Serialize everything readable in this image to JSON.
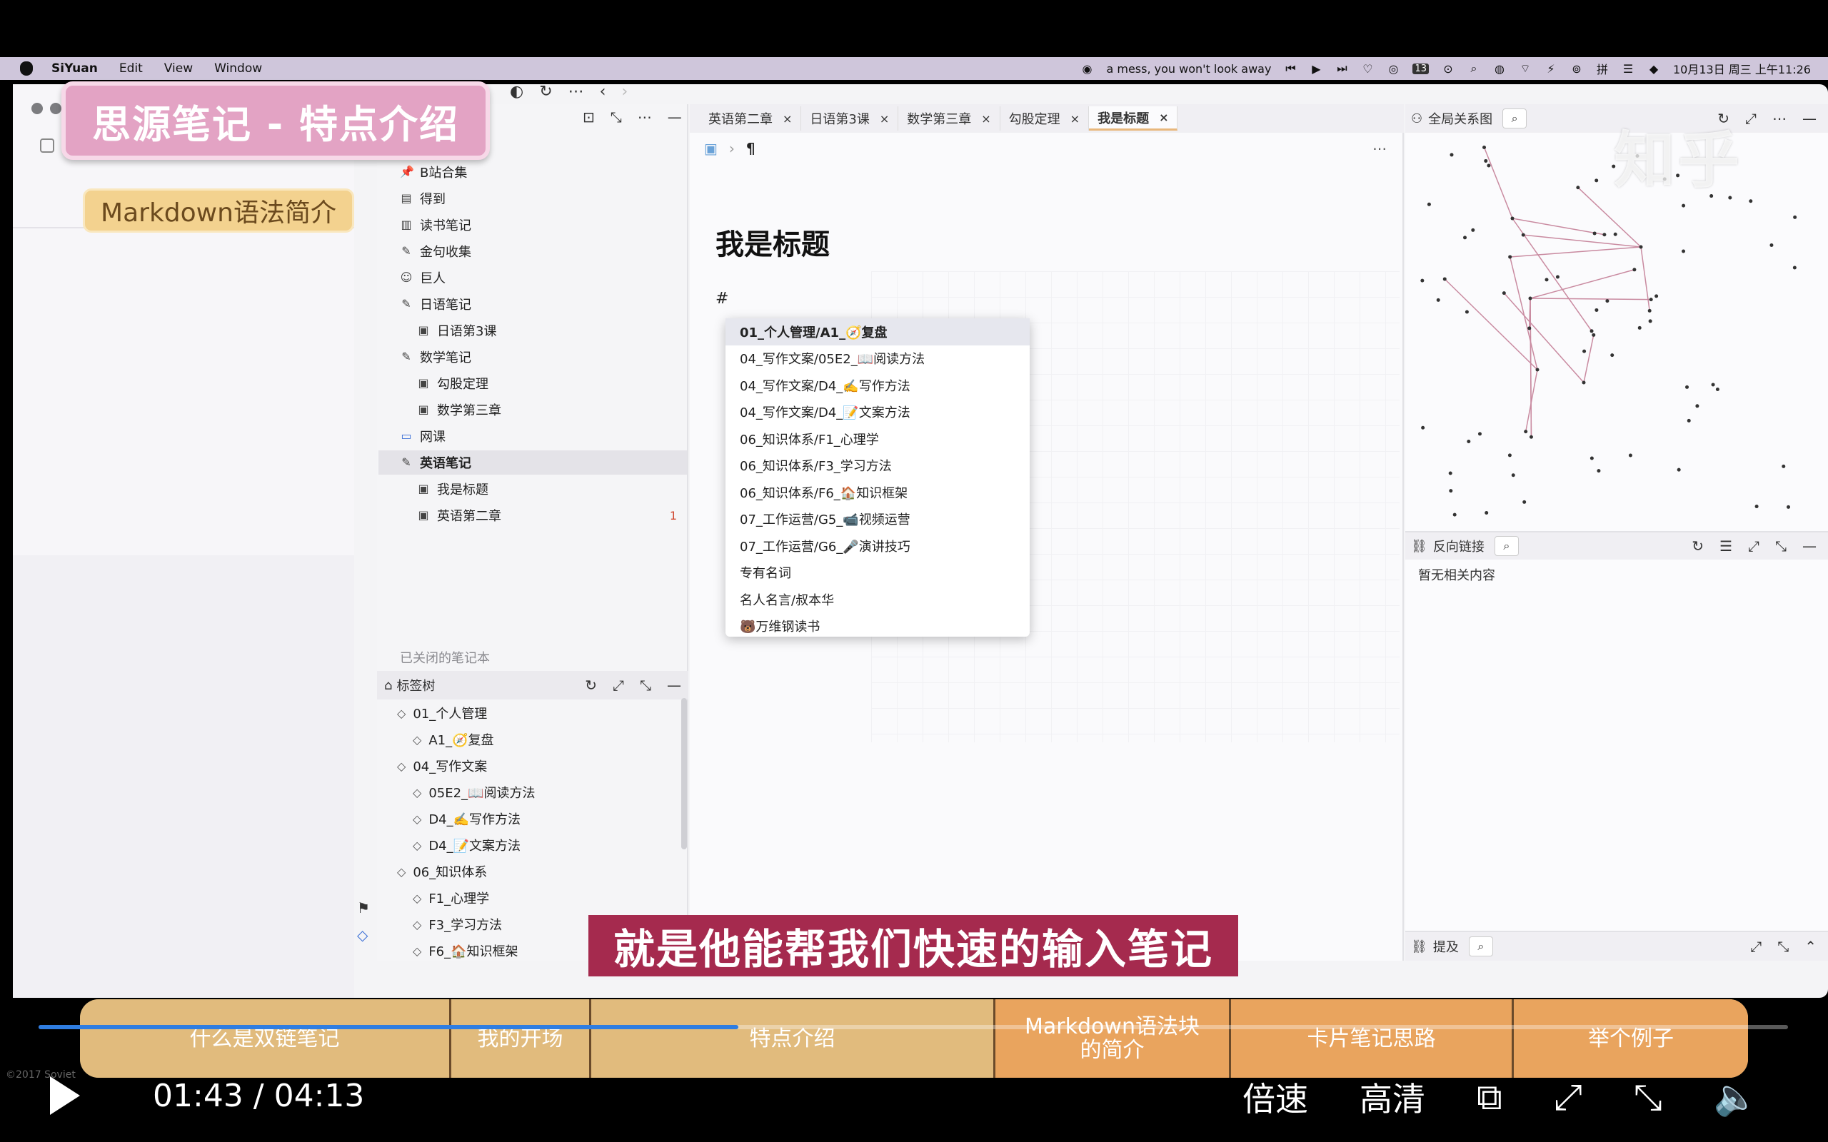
{
  "menubar": {
    "app_name": "SiYuan",
    "menus": [
      "Edit",
      "View",
      "Window"
    ],
    "now_playing": "a mess, you won't look away",
    "calendar_badge": "13",
    "datetime": "10月13日 周三 上午11:26"
  },
  "overlay": {
    "title": "思源笔记 - 特点介绍",
    "subtitle": "Markdown语法简介"
  },
  "notebook_tree": {
    "items": [
      {
        "label": "B站合集",
        "icon": "pin-icon",
        "level": 1
      },
      {
        "label": "得到",
        "icon": "folder-icon",
        "level": 1
      },
      {
        "label": "读书笔记",
        "icon": "book-icon",
        "level": 1
      },
      {
        "label": "金句收集",
        "icon": "note-icon",
        "level": 1
      },
      {
        "label": "巨人",
        "icon": "person-icon",
        "level": 1
      },
      {
        "label": "日语笔记",
        "icon": "note-icon",
        "level": 1
      },
      {
        "label": "日语第3课",
        "icon": "doc-icon",
        "level": 2
      },
      {
        "label": "数学笔记",
        "icon": "note-icon",
        "level": 1
      },
      {
        "label": "勾股定理",
        "icon": "doc-icon",
        "level": 2
      },
      {
        "label": "数学第三章",
        "icon": "doc-icon",
        "level": 2
      },
      {
        "label": "网课",
        "icon": "laptop-icon",
        "level": 1
      },
      {
        "label": "英语笔记",
        "icon": "note-icon",
        "level": 1,
        "active": true
      },
      {
        "label": "我是标题",
        "icon": "doc-icon",
        "level": 2
      },
      {
        "label": "英语第二章",
        "icon": "doc-icon",
        "level": 2,
        "count": "1"
      }
    ],
    "closed_label": "已关闭的笔记本"
  },
  "tag_tree": {
    "title": "标签树",
    "items": [
      {
        "label": "01_个人管理",
        "level": 1
      },
      {
        "label": "A1_🧭复盘",
        "level": 2
      },
      {
        "label": "04_写作文案",
        "level": 1
      },
      {
        "label": "05E2_📖阅读方法",
        "level": 2
      },
      {
        "label": "D4_✍️写作方法",
        "level": 2
      },
      {
        "label": "D4_📝文案方法",
        "level": 2
      },
      {
        "label": "06_知识体系",
        "level": 1
      },
      {
        "label": "F1_心理学",
        "level": 2
      },
      {
        "label": "F3_学习方法",
        "level": 2
      },
      {
        "label": "F6_🏠知识框架",
        "level": 2
      }
    ]
  },
  "editor": {
    "tabs": [
      {
        "label": "英语第二章"
      },
      {
        "label": "日语第3课"
      },
      {
        "label": "数学第三章"
      },
      {
        "label": "勾股定理"
      },
      {
        "label": "我是标题",
        "active": true
      }
    ],
    "breadcrumb_mark": "¶",
    "doc_title": "我是标题",
    "typed": "#",
    "dropdown": [
      "01_个人管理/A1_🧭复盘",
      "04_写作文案/05E2_📖阅读方法",
      "04_写作文案/D4_✍️写作方法",
      "04_写作文案/D4_📝文案方法",
      "06_知识体系/F1_心理学",
      "06_知识体系/F3_学习方法",
      "06_知识体系/F6_🏠知识框架",
      "07_工作运营/G5_📹视频运营",
      "07_工作运营/G6_🎤演讲技巧",
      "专有名词",
      "名人名言/叔本华",
      "🐻万维钢读书"
    ]
  },
  "right_panels": {
    "graph_title": "全局关系图",
    "watermark": "知乎",
    "backlink_title": "反向链接",
    "backlink_empty": "暂无相关内容",
    "mention_title": "提及"
  },
  "video": {
    "subtitle": "就是他能帮我们快速的输入笔记",
    "chapters": [
      "什么是双链笔记",
      "我的开场",
      "特点介绍",
      "Markdown语法块 的简介",
      "卡片笔记思路",
      "举个例子"
    ],
    "progress": 0.4,
    "time": "01:43 / 04:13",
    "speed_label": "倍速",
    "quality_label": "高清",
    "copyright": "©2017 Soviet"
  },
  "colors": {
    "overlay_title_bg": "#e3a3c4",
    "overlay_sub_bg": "#f3d28f",
    "subtitle_bg": "#a52a4e",
    "chapter_bg": "#efcd93",
    "progress": "#2f7de1",
    "graph_edge": "#c98aa0"
  }
}
